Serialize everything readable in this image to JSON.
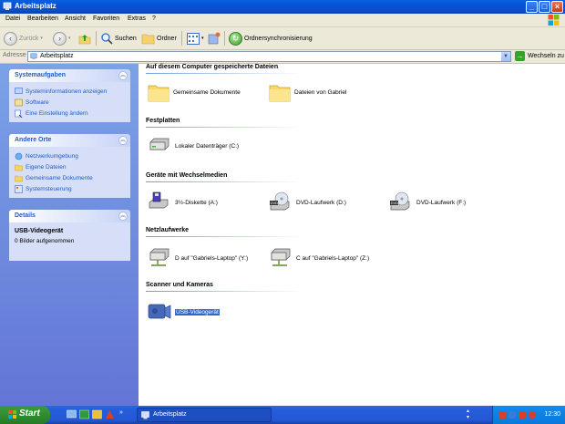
{
  "window": {
    "title": "Arbeitsplatz"
  },
  "menu": [
    "Datei",
    "Bearbeiten",
    "Ansicht",
    "Favoriten",
    "Extras",
    "?"
  ],
  "toolbar": {
    "back": "Zurück",
    "search": "Suchen",
    "folders": "Ordner",
    "sync": "Ordnersynchronisierung"
  },
  "address": {
    "label": "Adresse",
    "value": "Arbeitsplatz",
    "go": "Wechseln zu"
  },
  "sidebar": {
    "system": {
      "title": "Systemaufgaben",
      "items": [
        "Systeminformationen anzeigen",
        "Software",
        "Eine Einstellung ändern"
      ]
    },
    "places": {
      "title": "Andere Orte",
      "items": [
        "Netzwerkumgebung",
        "Eigene Dateien",
        "Gemeinsame Dokumente",
        "Systemsteuerung"
      ]
    },
    "details": {
      "title": "Details",
      "name": "USB-Videogerät",
      "info": "0 Bilder aufgenommen"
    }
  },
  "sections": {
    "stored": {
      "title": "Auf diesem Computer gespeicherte Dateien",
      "items": [
        "Gemeinsame Dokumente",
        "Dateien von Gabriel"
      ]
    },
    "drives": {
      "title": "Festplatten",
      "items": [
        "Lokaler Datenträger (C:)"
      ]
    },
    "removable": {
      "title": "Geräte mit Wechselmedien",
      "items": [
        "3½-Diskette (A:)",
        "DVD-Laufwerk (D:)",
        "DVD-Laufwerk (F:)"
      ]
    },
    "network": {
      "title": "Netzlaufwerke",
      "items": [
        "D auf \"Gabriels-Laptop\" (Y:)",
        "C auf \"Gabriels-Laptop\" (Z:)"
      ]
    },
    "scanners": {
      "title": "Scanner und Kameras",
      "items": [
        "USB-Videogerät"
      ]
    }
  },
  "taskbar": {
    "start": "Start",
    "task": "Arbeitsplatz",
    "time": "12:30"
  },
  "colors": {
    "titlebar": "#0a5fe0",
    "sidebar": "#7ba2e7",
    "selection": "#316ac5",
    "start": "#3c9a3c"
  }
}
